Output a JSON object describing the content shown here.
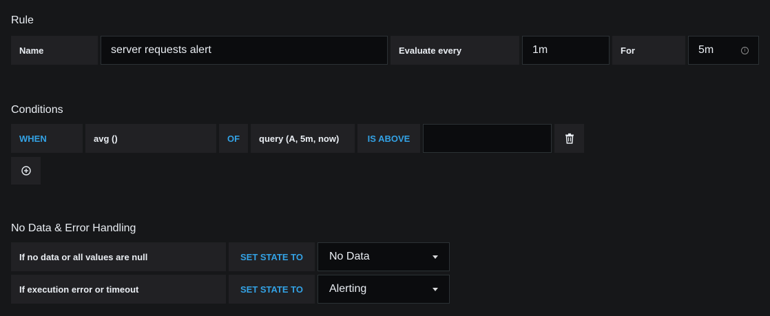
{
  "rule": {
    "title": "Rule",
    "name_label": "Name",
    "name_value": "server requests alert",
    "evaluate_label": "Evaluate every",
    "evaluate_value": "1m",
    "for_label": "For",
    "for_value": "5m",
    "info_icon": "info-circle-icon"
  },
  "conditions": {
    "title": "Conditions",
    "when": "WHEN",
    "reducer": "avg ()",
    "of": "OF",
    "query": "query (A, 5m, now)",
    "evaluator": "IS ABOVE",
    "threshold": "",
    "delete_icon": "trash-icon",
    "add_icon": "plus-circle-icon"
  },
  "handling": {
    "title": "No Data & Error Handling",
    "rows": [
      {
        "label": "If no data or all values are null",
        "set_state": "SET STATE TO",
        "value": "No Data"
      },
      {
        "label": "If execution error or timeout",
        "set_state": "SET STATE TO",
        "value": "Alerting"
      }
    ]
  },
  "colors": {
    "background": "#161719",
    "label_bg": "#212124",
    "input_bg": "#0b0c0e",
    "keyword": "#33a2e5",
    "text": "#e9edf2"
  }
}
